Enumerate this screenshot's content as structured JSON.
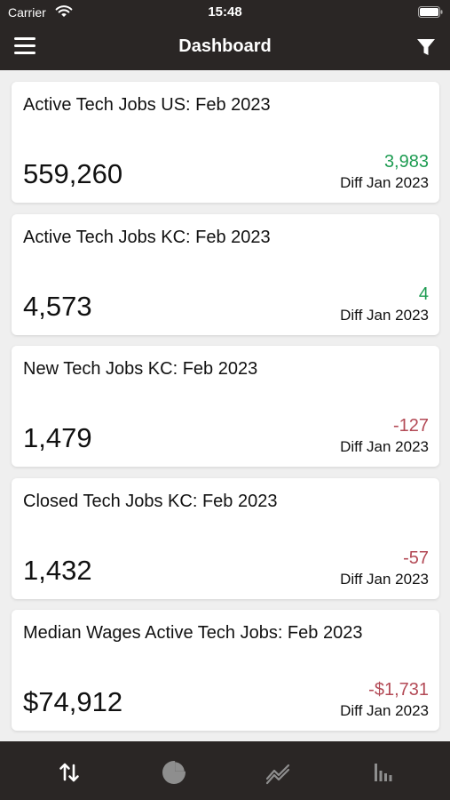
{
  "status_bar": {
    "carrier": "Carrier",
    "time": "15:48"
  },
  "nav": {
    "title": "Dashboard",
    "left_icon": "hamburger-menu-icon",
    "right_icon": "filter-icon"
  },
  "cards": [
    {
      "title": "Active Tech Jobs US: Feb 2023",
      "value": "559,260",
      "diff": "3,983",
      "diff_trend": "positive",
      "diff_label": "Diff Jan 2023"
    },
    {
      "title": "Active Tech Jobs KC: Feb 2023",
      "value": "4,573",
      "diff": "4",
      "diff_trend": "positive",
      "diff_label": "Diff Jan 2023"
    },
    {
      "title": "New Tech Jobs KC: Feb 2023",
      "value": "1,479",
      "diff": "-127",
      "diff_trend": "negative",
      "diff_label": "Diff Jan 2023"
    },
    {
      "title": "Closed Tech Jobs KC: Feb 2023",
      "value": "1,432",
      "diff": "-57",
      "diff_trend": "negative",
      "diff_label": "Diff Jan 2023"
    },
    {
      "title": "Median Wages Active Tech Jobs: Feb 2023",
      "value": "$74,912",
      "diff": "-$1,731",
      "diff_trend": "negative",
      "diff_label": "Diff Jan 2023"
    }
  ],
  "tab_bar": {
    "tabs": [
      {
        "icon": "sort-arrows-icon",
        "active": true
      },
      {
        "icon": "pie-chart-icon",
        "active": false
      },
      {
        "icon": "line-chart-icon",
        "active": false
      },
      {
        "icon": "bar-chart-icon",
        "active": false
      }
    ]
  },
  "colors": {
    "bar_background": "#2a2625",
    "page_background": "#efefef",
    "positive": "#1e9c52",
    "negative": "#b34a56",
    "tab_active": "#ffffff",
    "tab_inactive": "#8e8e8e"
  }
}
